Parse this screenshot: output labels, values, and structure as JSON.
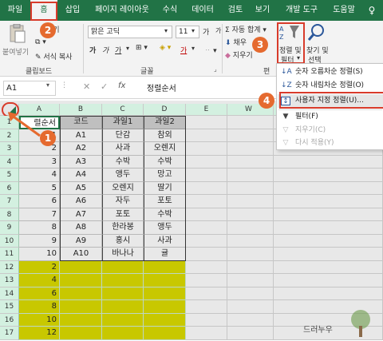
{
  "ribbon_tabs": [
    "파일",
    "홈",
    "삽입",
    "페이지 레이아웃",
    "수식",
    "데이터",
    "검토",
    "보기",
    "개발 도구",
    "도움말"
  ],
  "active_tab_index": 1,
  "clipboard": {
    "paste_label": "붙여넣기",
    "cut_label": "내기",
    "format_painter_label": "서식 복사",
    "group_label": "클립보드"
  },
  "font": {
    "font_name": "맑은 고딕",
    "font_size": "11",
    "bold": "가",
    "italic": "가",
    "underline": "가",
    "strike": "가",
    "grow": "가",
    "shrink": "가",
    "group_label": "글꼴"
  },
  "editing": {
    "autosum_label": "자동 합계",
    "fill_label": "채우",
    "clear_label": "지우기",
    "sort_filter_label_1": "정렬 및",
    "sort_filter_label_2": "필터",
    "find_select_label_1": "찾기 및",
    "find_select_label_2": "선택",
    "group_label": "편"
  },
  "formula_bar": {
    "name_box": "A1",
    "fx": "fx",
    "content": "정렬순서"
  },
  "columns": [
    "A",
    "B",
    "C",
    "D",
    "E",
    "W"
  ],
  "rows": [
    {
      "num": "1",
      "a": "렬순서",
      "b": "코드",
      "c": "과일1",
      "d": "과일2"
    },
    {
      "num": "2",
      "a": "1",
      "b": "A1",
      "c": "단감",
      "d": "참외"
    },
    {
      "num": "3",
      "a": "2",
      "b": "A2",
      "c": "사과",
      "d": "오렌지"
    },
    {
      "num": "4",
      "a": "3",
      "b": "A3",
      "c": "수박",
      "d": "수박"
    },
    {
      "num": "5",
      "a": "4",
      "b": "A4",
      "c": "앵두",
      "d": "망고"
    },
    {
      "num": "6",
      "a": "5",
      "b": "A5",
      "c": "오렌지",
      "d": "딸기"
    },
    {
      "num": "7",
      "a": "6",
      "b": "A6",
      "c": "자두",
      "d": "포토"
    },
    {
      "num": "8",
      "a": "7",
      "b": "A7",
      "c": "포토",
      "d": "수박"
    },
    {
      "num": "9",
      "a": "8",
      "b": "A8",
      "c": "한라봉",
      "d": "앵두"
    },
    {
      "num": "10",
      "a": "9",
      "b": "A9",
      "c": "홍시",
      "d": "사과"
    },
    {
      "num": "11",
      "a": "10",
      "b": "A10",
      "c": "바나나",
      "d": "귤"
    },
    {
      "num": "12",
      "a": "2",
      "b": "",
      "c": "",
      "d": ""
    },
    {
      "num": "13",
      "a": "4",
      "b": "",
      "c": "",
      "d": ""
    },
    {
      "num": "14",
      "a": "6",
      "b": "",
      "c": "",
      "d": ""
    },
    {
      "num": "15",
      "a": "8",
      "b": "",
      "c": "",
      "d": ""
    },
    {
      "num": "16",
      "a": "10",
      "b": "",
      "c": "",
      "d": ""
    },
    {
      "num": "17",
      "a": "12",
      "b": "",
      "c": "",
      "d": ""
    }
  ],
  "sort_menu": [
    {
      "icon": "sort-ascending-icon",
      "label": "숫자 오름차순 정렬(S)",
      "disabled": false
    },
    {
      "icon": "sort-descending-icon",
      "label": "숫자 내림차순 정렬(O)",
      "disabled": false
    },
    {
      "icon": "custom-sort-icon",
      "label": "사용자 지정 정렬(U)...",
      "disabled": false
    },
    {
      "icon": "filter-icon",
      "label": "필터(F)",
      "disabled": false
    },
    {
      "icon": "clear-filter-icon",
      "label": "지우기(C)",
      "disabled": true
    },
    {
      "icon": "reapply-icon",
      "label": "다시 적용(Y)",
      "disabled": true
    }
  ],
  "badges": [
    "2",
    "3",
    "4",
    "1"
  ],
  "watermark": "드러누우",
  "colors": {
    "excel_green": "#217346",
    "header_fill": "#d3f0e0",
    "highlight_fill": "#c8c800",
    "badge_orange": "#e56a2f",
    "marker_red": "#d83b2b"
  }
}
